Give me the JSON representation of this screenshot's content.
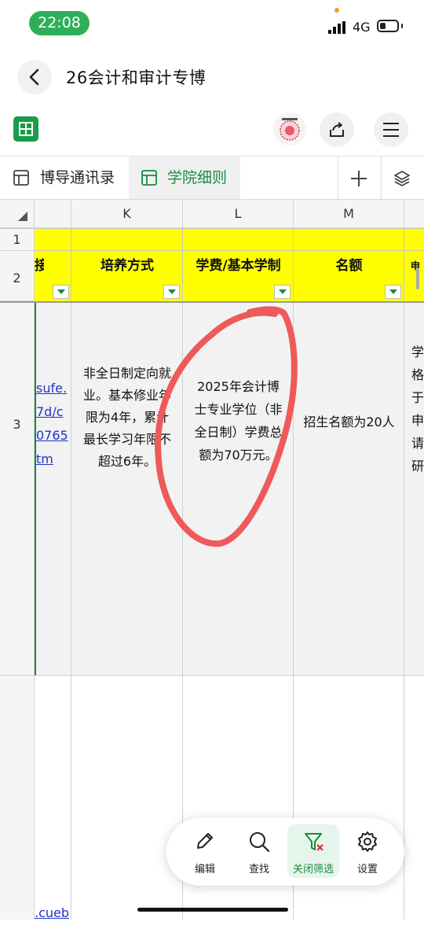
{
  "status_bar": {
    "time": "22:08",
    "network": "4G"
  },
  "nav": {
    "title": "26会计和审计专博"
  },
  "tabs": [
    {
      "label": "博导通讯录",
      "active": false
    },
    {
      "label": "学院细则",
      "active": true
    }
  ],
  "grid": {
    "columns": [
      "K",
      "L",
      "M"
    ],
    "rows": [
      "1",
      "2",
      "3"
    ],
    "headers": {
      "partial_left": "接",
      "k": "培养方式",
      "l": "学费/基本学制",
      "m": "名额",
      "partial_right": "申"
    },
    "row3": {
      "link_lines": [
        "sufe.",
        "7d/c",
        "0765",
        "tm"
      ],
      "k_lines": [
        "非全日制定向就",
        "业。基本修业年",
        "限为4年，累计",
        "最长学习年限不",
        "超过6年。"
      ],
      "l_lines": [
        "2025年会计博",
        "士专业学位（非",
        "全日制）学费总",
        "额为70万元。"
      ],
      "m": "招生名额为20人",
      "partial_right_chars": [
        "学",
        "格",
        "于",
        "申",
        "请",
        "研"
      ]
    },
    "row4_link": ".cueb"
  },
  "floating_toolbar": {
    "edit": "编辑",
    "find": "查找",
    "close_filter": "关闭筛选",
    "settings": "设置"
  },
  "colors": {
    "header_fill": "#ffff00",
    "accent": "#1a9c4a",
    "annotation": "#ee5a5a"
  }
}
